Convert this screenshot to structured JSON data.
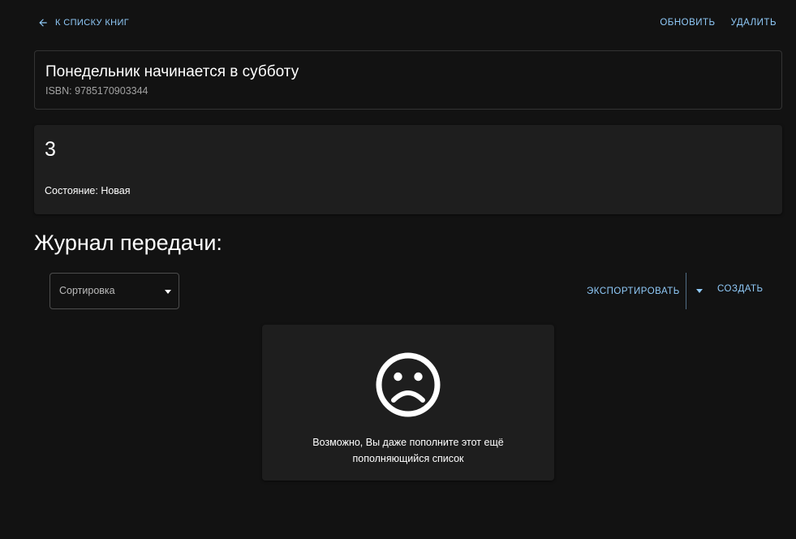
{
  "header": {
    "back_label": "К СПИСКУ КНИГ",
    "back_icon": "arrow-left-icon",
    "refresh_label": "ОБНОВИТЬ",
    "delete_label": "УДАЛИТЬ"
  },
  "book": {
    "title": "Понедельник начинается в субботу",
    "isbn": "ISBN: 9785170903344"
  },
  "copy": {
    "number": "3",
    "state": "Состояние: Новая"
  },
  "journal": {
    "heading": "Журнал передачи:",
    "sort_label": "Сортировка",
    "export_label": "ЭКСПОРТИРОВАТЬ",
    "create_label": "СОЗДАТЬ",
    "empty_icon": "sad-face-icon",
    "empty_line1": "Возможно, Вы даже пополните этот ещё",
    "empty_line2": "пополняющийся список"
  },
  "colors": {
    "background": "#121212",
    "card": "#1e1e1e",
    "accent": "#90caf9"
  }
}
